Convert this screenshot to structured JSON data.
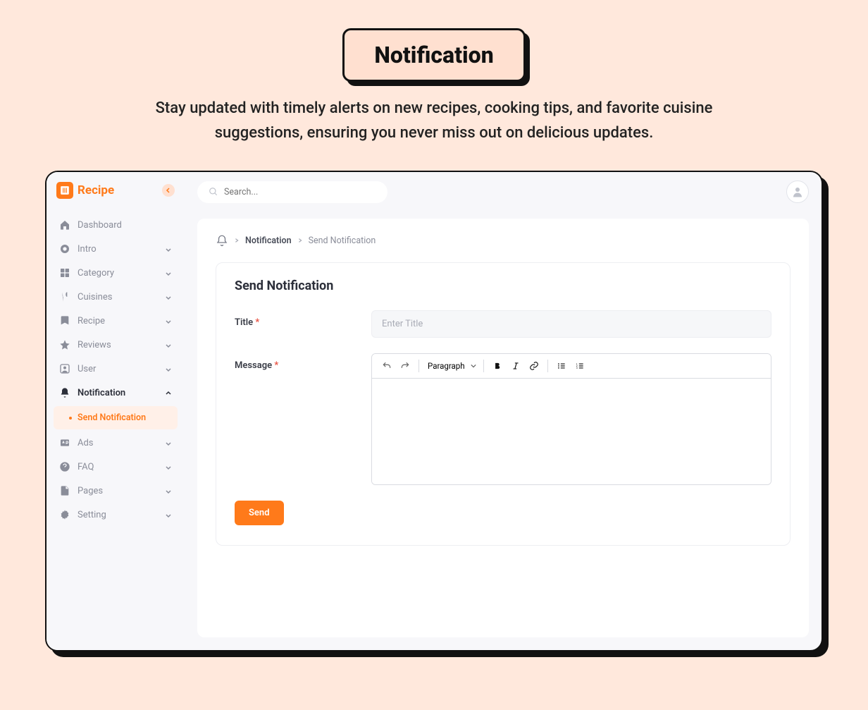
{
  "hero": {
    "title": "Notification",
    "subtitle": "Stay updated with timely alerts on new recipes, cooking tips, and favorite cuisine suggestions, ensuring you never miss out on delicious updates."
  },
  "brand": {
    "name": "Recipe"
  },
  "search": {
    "placeholder": "Search..."
  },
  "sidebar": {
    "items": [
      {
        "label": "Dashboard",
        "icon": "home",
        "expandable": false
      },
      {
        "label": "Intro",
        "icon": "circle",
        "expandable": true
      },
      {
        "label": "Category",
        "icon": "grid",
        "expandable": true
      },
      {
        "label": "Cuisines",
        "icon": "utensils",
        "expandable": true
      },
      {
        "label": "Recipe",
        "icon": "book",
        "expandable": true
      },
      {
        "label": "Reviews",
        "icon": "star",
        "expandable": true
      },
      {
        "label": "User",
        "icon": "user",
        "expandable": true
      },
      {
        "label": "Notification",
        "icon": "bell",
        "expandable": true,
        "active": true,
        "expanded": true
      },
      {
        "label": "Ads",
        "icon": "ad",
        "expandable": true
      },
      {
        "label": "FAQ",
        "icon": "question",
        "expandable": true
      },
      {
        "label": "Pages",
        "icon": "file",
        "expandable": true
      },
      {
        "label": "Setting",
        "icon": "gear",
        "expandable": true
      }
    ],
    "notification_subitems": [
      {
        "label": "Send Notification",
        "active": true
      }
    ]
  },
  "breadcrumb": {
    "section": "Notification",
    "current": "Send Notification"
  },
  "form": {
    "heading": "Send Notification",
    "title_label": "Title",
    "title_placeholder": "Enter Title",
    "title_value": "",
    "message_label": "Message",
    "message_value": "",
    "send_label": "Send"
  },
  "editor": {
    "block_format": "Paragraph"
  }
}
